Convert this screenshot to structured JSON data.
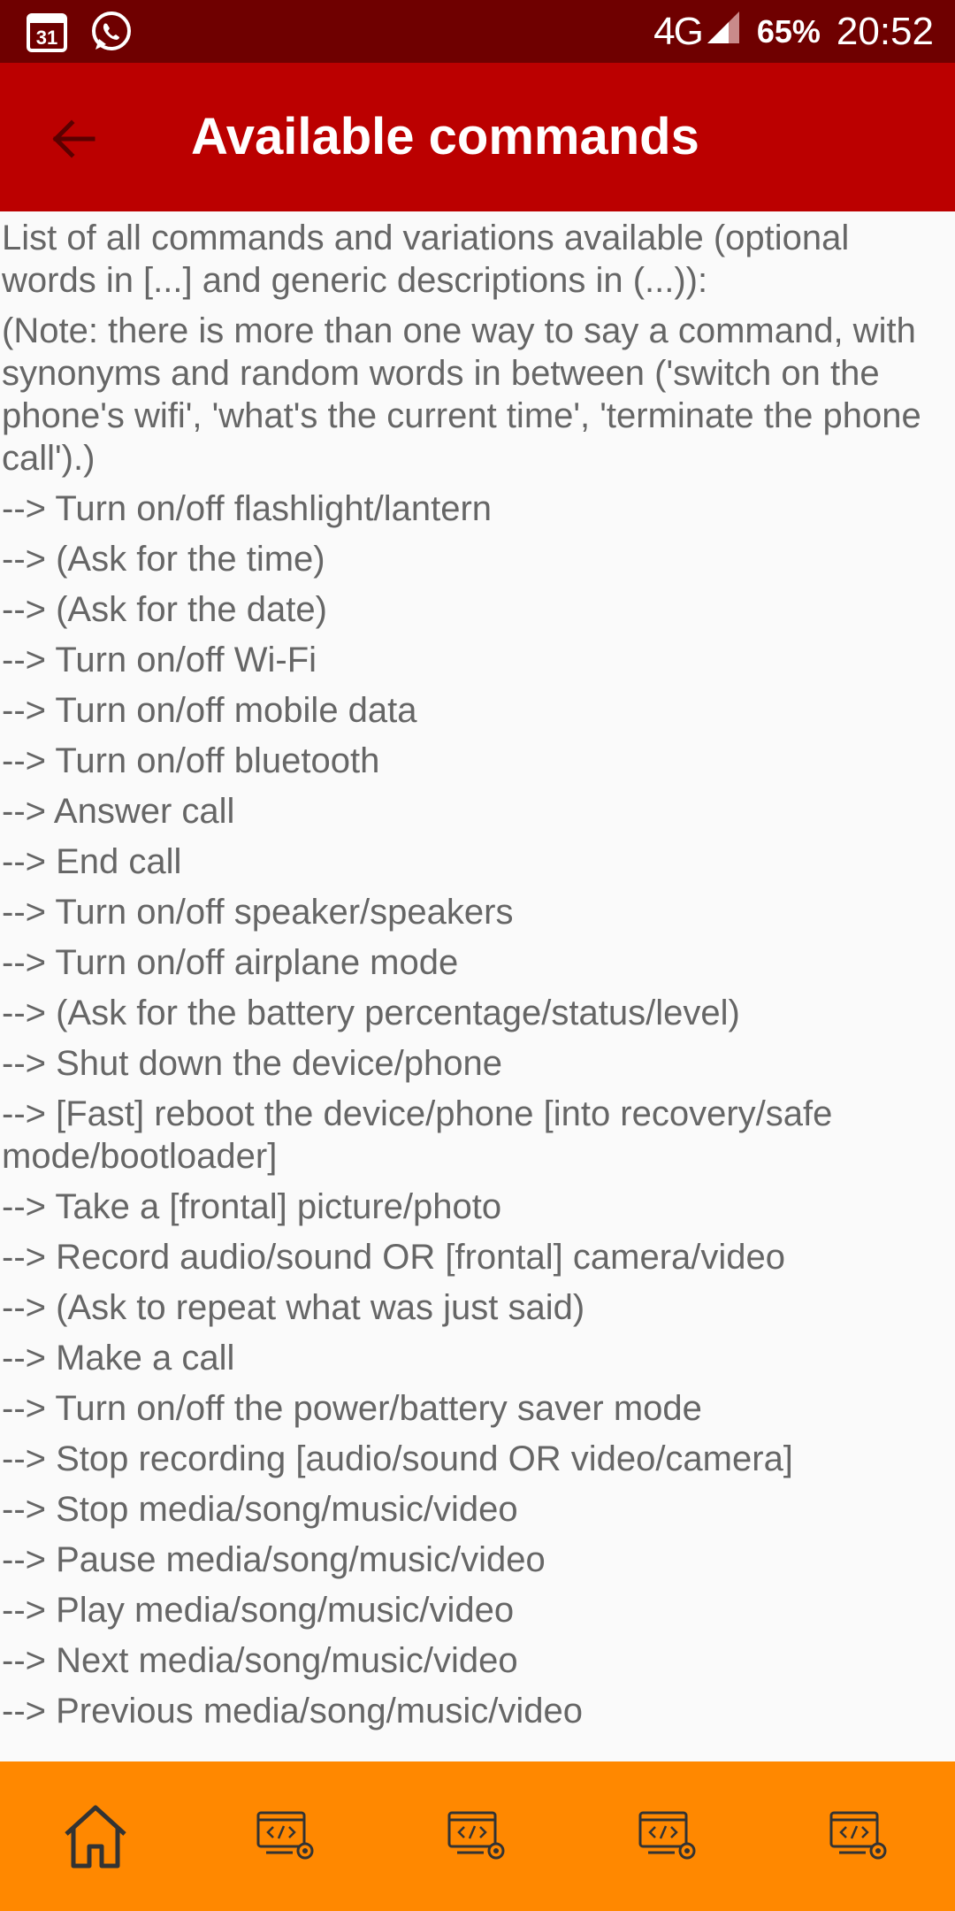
{
  "status_bar": {
    "calendar_day": "31",
    "network": "4G",
    "battery": "65%",
    "time": "20:52"
  },
  "app_bar": {
    "title": "Available commands"
  },
  "content": {
    "intro": "List of all commands and variations available (optional words in [...] and generic descriptions in (...)):",
    "note": "(Note: there is more than one way to say a command, with synonyms and random words in between ('switch on the phone's wifi', 'what's the current time', 'terminate the phone call').)",
    "commands": [
      "--> Turn on/off flashlight/lantern",
      "--> (Ask for the time)",
      "--> (Ask for the date)",
      "--> Turn on/off Wi-Fi",
      "--> Turn on/off mobile data",
      "--> Turn on/off bluetooth",
      "--> Answer call",
      "--> End call",
      "--> Turn on/off speaker/speakers",
      "--> Turn on/off airplane mode",
      "--> (Ask for the battery percentage/status/level)",
      "--> Shut down the device/phone",
      "--> [Fast] reboot the device/phone [into recovery/safe mode/bootloader]",
      "--> Take a [frontal] picture/photo",
      "--> Record audio/sound OR [frontal] camera/video",
      "--> (Ask to repeat what was just said)",
      "--> Make a call",
      "--> Turn on/off the power/battery saver mode",
      "--> Stop recording [audio/sound OR video/camera]",
      "--> Stop media/song/music/video",
      "--> Pause media/song/music/video",
      "--> Play media/song/music/video",
      "--> Next media/song/music/video",
      "--> Previous media/song/music/video"
    ]
  },
  "bottom_nav": {
    "items": [
      "home-icon",
      "developer-settings-icon",
      "developer-settings-icon",
      "developer-settings-icon",
      "developer-settings-icon"
    ]
  },
  "colors": {
    "status_bar": "#6f0000",
    "app_bar": "#bb0000",
    "bottom_nav": "#ff8800",
    "text": "#666666",
    "background": "#fafafa"
  }
}
